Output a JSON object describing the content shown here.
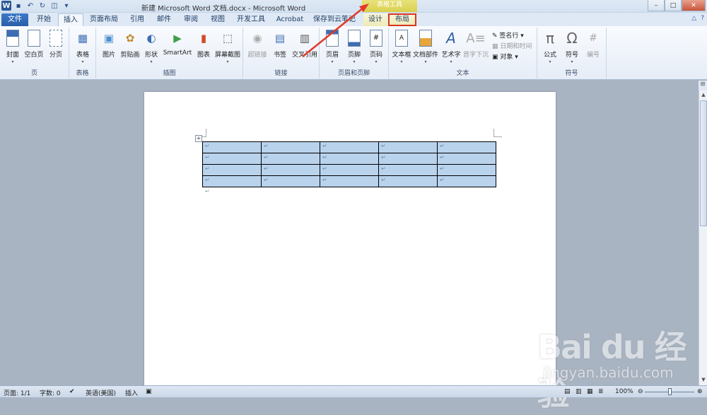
{
  "window": {
    "title": "新建 Microsoft Word 文档.docx - Microsoft Word",
    "context_group": "表格工具",
    "qat_icons": [
      "word-icon",
      "save-icon",
      "undo-icon",
      "redo-icon",
      "print-preview-icon",
      "customize-icon"
    ],
    "controls": {
      "minimize": "–",
      "restore": "□",
      "close": "✕"
    }
  },
  "tabs": [
    "文件",
    "开始",
    "插入",
    "页面布局",
    "引用",
    "邮件",
    "审阅",
    "视图",
    "开发工具",
    "Acrobat",
    "保存到云笔记",
    "设计",
    "布局"
  ],
  "active_tab": "插入",
  "highlighted_tab": "布局",
  "ribbon": {
    "groups": {
      "pages": {
        "label": "页",
        "buttons": [
          "封面",
          "空白页",
          "分页"
        ]
      },
      "tables": {
        "label": "表格",
        "buttons": [
          "表格"
        ]
      },
      "illustrations": {
        "label": "插图",
        "buttons": [
          "图片",
          "剪贴画",
          "形状",
          "SmartArt",
          "图表",
          "屏幕截图"
        ]
      },
      "links": {
        "label": "链接",
        "buttons": [
          "超链接",
          "书签",
          "交叉引用"
        ]
      },
      "header_footer": {
        "label": "页眉和页脚",
        "buttons": [
          "页眉",
          "页脚",
          "页码"
        ]
      },
      "text": {
        "label": "文本",
        "buttons": [
          "文本框",
          "文档部件",
          "艺术字",
          "首字下沉"
        ],
        "small": [
          "签名行",
          "日期和时间",
          "对象"
        ]
      },
      "symbols": {
        "label": "符号",
        "buttons": [
          "公式",
          "符号",
          "编号"
        ]
      }
    }
  },
  "document": {
    "table": {
      "rows": 4,
      "cols": 5,
      "cell_mark": "↵"
    },
    "end_mark": "↵"
  },
  "statusbar": {
    "page": "页面: 1/1",
    "words": "字数: 0",
    "language": "英语(美国)",
    "mode": "插入",
    "zoom": "100%",
    "zoom_level": 1.0
  },
  "watermark": {
    "brand": "Bai du 经验",
    "url": "jingyan.baidu.com"
  },
  "colors": {
    "file_tab": "#2b5797",
    "context_group": "#d9d04e",
    "highlight": "#d9371f",
    "table_fill": "#b9d3ed",
    "arrow": "#e2392a"
  }
}
